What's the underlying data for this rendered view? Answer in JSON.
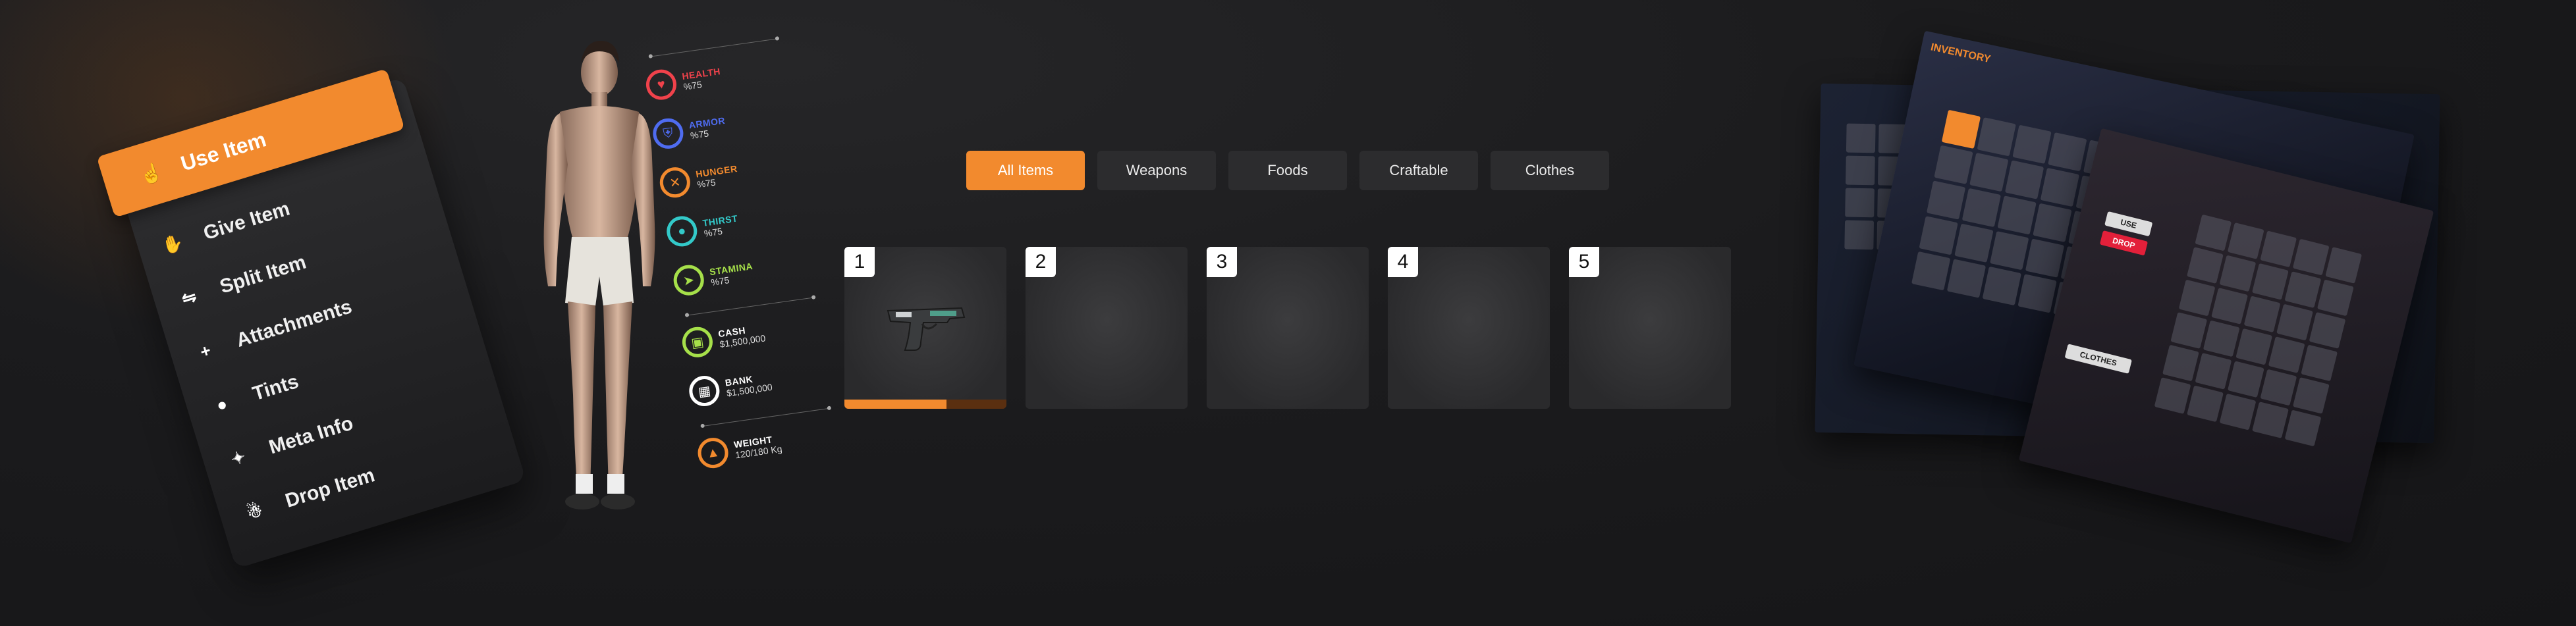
{
  "context_menu": {
    "active": {
      "label": "Use Item",
      "icon": "hand-icon"
    },
    "items": [
      {
        "label": "Give Item",
        "icon": "hand-give-icon"
      },
      {
        "label": "Split Item",
        "icon": "split-icon"
      },
      {
        "label": "Attachments",
        "icon": "plus-icon"
      },
      {
        "label": "Tints",
        "icon": "palette-icon"
      },
      {
        "label": "Meta Info",
        "icon": "sparkle-icon"
      },
      {
        "label": "Drop Item",
        "icon": "drop-icon"
      }
    ]
  },
  "stats": [
    {
      "name": "HEALTH",
      "value": "%75",
      "color": "#f0424b",
      "icon": "heart-icon",
      "level": 0.75
    },
    {
      "name": "ARMOR",
      "value": "%75",
      "color": "#4f6cf0",
      "icon": "shield-icon",
      "level": 0.75
    },
    {
      "name": "HUNGER",
      "value": "%75",
      "color": "#f28a2e",
      "icon": "fork-knife-icon",
      "level": 0.75
    },
    {
      "name": "THIRST",
      "value": "%75",
      "color": "#33c9c9",
      "icon": "drop-icon",
      "level": 0.75
    },
    {
      "name": "STAMINA",
      "value": "%75",
      "color": "#a6e04a",
      "icon": "run-icon",
      "level": 0.75
    }
  ],
  "money": [
    {
      "name": "CASH",
      "value": "$1,500,000",
      "color": "#a6e04a",
      "icon": "wallet-icon"
    },
    {
      "name": "BANK",
      "value": "$1,500,000",
      "color": "#ffffff",
      "icon": "bank-icon"
    }
  ],
  "weight": {
    "name": "WEIGHT",
    "value": "120/180 Kg",
    "color": "#f28a2e",
    "icon": "weight-icon"
  },
  "tabs": [
    {
      "label": "All Items",
      "active": true
    },
    {
      "label": "Weapons",
      "active": false
    },
    {
      "label": "Foods",
      "active": false
    },
    {
      "label": "Craftable",
      "active": false
    },
    {
      "label": "Clothes",
      "active": false
    }
  ],
  "slots": [
    {
      "number": "1",
      "item": "pistol",
      "durability": 0.63
    },
    {
      "number": "2",
      "item": null
    },
    {
      "number": "3",
      "item": null
    },
    {
      "number": "4",
      "item": null
    },
    {
      "number": "5",
      "item": null
    }
  ],
  "preview": {
    "title": "INVENTORY",
    "use_label": "USE",
    "drop_label": "DROP",
    "clothes_label": "CLOTHES"
  },
  "colors": {
    "accent": "#f28a2e",
    "background": "#1b1b1d",
    "slot": "#2e2e30"
  }
}
